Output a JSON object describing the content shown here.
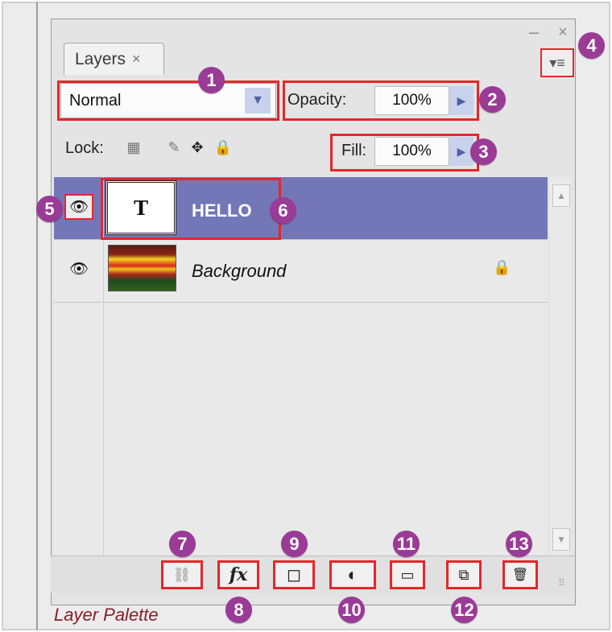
{
  "panel": {
    "tab_label": "Layers",
    "tab_close": "×",
    "minimize": "–",
    "close": "×",
    "menu_icon": "▾≡"
  },
  "blend_mode": {
    "value": "Normal"
  },
  "opacity": {
    "label": "Opacity:",
    "value": "100%"
  },
  "lock": {
    "label": "Lock:"
  },
  "fill": {
    "label": "Fill:",
    "value": "100%"
  },
  "layers": [
    {
      "name": "HELLO",
      "thumb": "T",
      "selected": true,
      "visible": true
    },
    {
      "name": "Background",
      "selected": false,
      "visible": true,
      "locked": true
    }
  ],
  "callouts": [
    "1",
    "2",
    "3",
    "4",
    "5",
    "6",
    "7",
    "8",
    "9",
    "10",
    "11",
    "12",
    "13"
  ],
  "bottom_tools": {
    "link": "⛓",
    "fx": "fx",
    "mask": "◻",
    "adjustment": "◐",
    "group": "▭",
    "new_layer": "⧉",
    "delete": "🗑"
  },
  "caption": "Layer Palette",
  "colors": {
    "selected_row": "#7377b7",
    "highlight": "#e6262a",
    "callout": "#9a3b96",
    "caption": "#8b1d2c"
  }
}
